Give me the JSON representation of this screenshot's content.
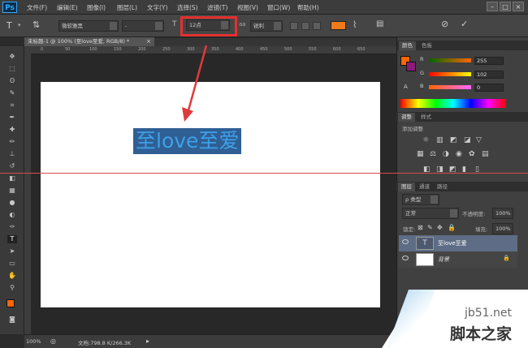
{
  "app": {
    "logo": "Ps"
  },
  "menubar": {
    "items": [
      "文件(F)",
      "编辑(E)",
      "图像(I)",
      "图层(L)",
      "文字(Y)",
      "选择(S)",
      "滤镜(T)",
      "视图(V)",
      "窗口(W)",
      "帮助(H)"
    ]
  },
  "options": {
    "font_family": "微软雅黑",
    "font_style": "-",
    "font_size": "12点",
    "antialias": "锐利",
    "text_color": "#f07a1a"
  },
  "document": {
    "tab_label": "未标题-1 @ 100% (至love至爱, RGB/8) *",
    "text_content": "至love至爱"
  },
  "ruler": {
    "ticks": [
      "0",
      "50",
      "100",
      "150",
      "200",
      "250",
      "300",
      "350",
      "400",
      "450",
      "500",
      "550",
      "600",
      "650"
    ]
  },
  "status": {
    "zoom": "100%",
    "doc_info": "文档:798.8 K/266.3K"
  },
  "color_panel": {
    "tabs": [
      "颜色",
      "色板"
    ],
    "r_label": "R",
    "g_label": "G",
    "b_label": "B",
    "r": "255",
    "g": "102",
    "b": "0",
    "foreground": "#ff6600",
    "background": "#8b1a7a"
  },
  "adjustments_panel": {
    "tabs": [
      "调整",
      "样式"
    ],
    "title": "添加调整"
  },
  "layers_panel": {
    "tabs": [
      "图层",
      "通道",
      "路径"
    ],
    "filter_label": "ρ 类型",
    "blend_mode": "正常",
    "opacity_label": "不透明度:",
    "opacity_value": "100%",
    "lock_label": "锁定:",
    "fill_label": "填充:",
    "fill_value": "100%",
    "layers": [
      {
        "name": "至love至爱",
        "type": "text"
      },
      {
        "name": "背景",
        "type": "background"
      }
    ]
  },
  "watermark": {
    "site": "jb51.net",
    "name": "脚本之家"
  }
}
